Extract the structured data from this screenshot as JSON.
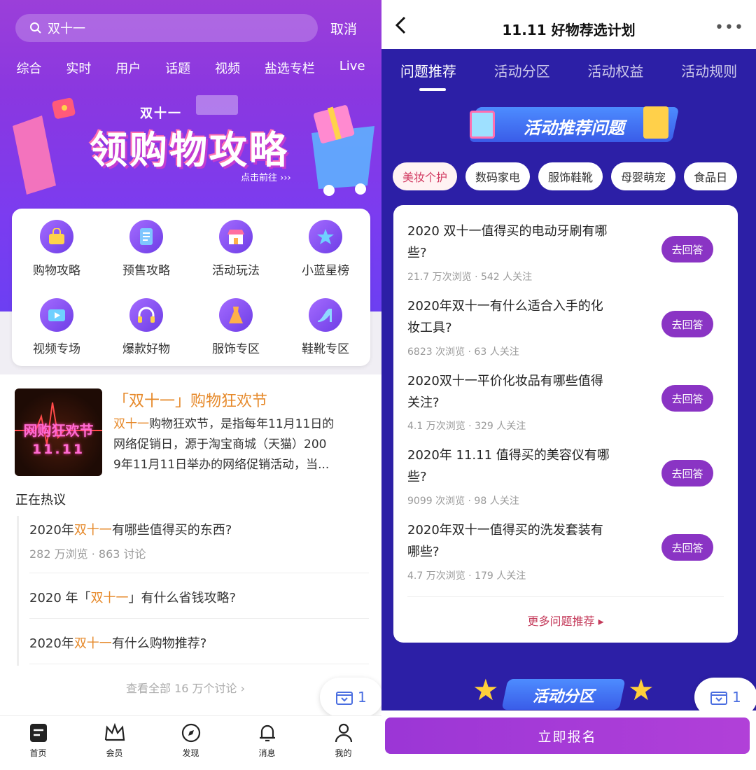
{
  "left": {
    "search": {
      "query": "双十一",
      "cancel": "取消"
    },
    "tabs": [
      "综合",
      "实时",
      "用户",
      "话题",
      "视频",
      "盐选专栏",
      "Live"
    ],
    "banner": {
      "pre": "双十一",
      "title": "领购物攻略",
      "cta": "点击前往 ›››"
    },
    "grid": [
      {
        "label": "购物攻略",
        "icon": "shopping-bag-icon"
      },
      {
        "label": "预售攻略",
        "icon": "document-icon"
      },
      {
        "label": "活动玩法",
        "icon": "store-icon"
      },
      {
        "label": "小蓝星榜",
        "icon": "star-icon"
      },
      {
        "label": "视频专场",
        "icon": "video-icon"
      },
      {
        "label": "爆款好物",
        "icon": "headphones-icon"
      },
      {
        "label": "服饰专区",
        "icon": "dress-icon"
      },
      {
        "label": "鞋靴专区",
        "icon": "high-heel-icon"
      }
    ],
    "topic": {
      "thumb_line1": "网购狂欢节",
      "thumb_line2": "11.11",
      "title": "「双十一」购物狂欢节",
      "desc_hl": "双十一",
      "desc_line1_rest": "购物狂欢节，是指每年11月11日的",
      "desc_line2": "网络促销日，源于淘宝商城（天猫）200",
      "desc_line3": "9年11月11日举办的网络促销活动，当..."
    },
    "hot": {
      "heading": "正在热议",
      "items": [
        {
          "pre": "2020年",
          "hl": "双十一",
          "post": "有哪些值得买的东西?",
          "meta": "282 万浏览 · 863 讨论"
        },
        {
          "pre": "2020 年「",
          "hl": "双十一",
          "post": "」有什么省钱攻略?",
          "meta": ""
        },
        {
          "pre": "2020年",
          "hl": "双十一",
          "post": "有什么购物推荐?",
          "meta": ""
        }
      ],
      "view_all": "查看全部 16 万个讨论  ›"
    },
    "float_count": "1",
    "nav": [
      {
        "label": "首页",
        "icon": "home-icon"
      },
      {
        "label": "会员",
        "icon": "crown-icon"
      },
      {
        "label": "发现",
        "icon": "compass-icon"
      },
      {
        "label": "消息",
        "icon": "bell-icon"
      },
      {
        "label": "我的",
        "icon": "profile-icon"
      }
    ]
  },
  "right": {
    "title": "11.11 好物荐选计划",
    "more": "•••",
    "tabs": [
      "问题推荐",
      "活动分区",
      "活动权益",
      "活动规则"
    ],
    "banner": "活动推荐问题",
    "chips": [
      "美妆个护",
      "数码家电",
      "服饰鞋靴",
      "母婴萌宠",
      "食品日"
    ],
    "questions": [
      {
        "line1": "2020 双十一值得买的电动牙刷有哪",
        "line2": "些?",
        "meta": "21.7 万次浏览 · 542 人关注"
      },
      {
        "line1": "2020年双十一有什么适合入手的化",
        "line2": "妆工具?",
        "meta": "6823 次浏览 · 63 人关注"
      },
      {
        "line1": "2020双十一平价化妆品有哪些值得",
        "line2": "关注?",
        "meta": "4.1 万次浏览 · 329 人关注"
      },
      {
        "line1": "2020年 11.11 值得买的美容仪有哪",
        "line2": "些?",
        "meta": "9099 次浏览 · 98 人关注"
      },
      {
        "line1": "2020年双十一值得买的洗发套装有",
        "line2": "哪些?",
        "meta": "4.7 万次浏览 · 179 人关注"
      }
    ],
    "answer_label": "去回答",
    "more_link": "更多问题推荐 ▸",
    "zone_banner": "活动分区",
    "float_count": "1",
    "register": "立即报名"
  },
  "colors": {
    "purple": "#8a37e0",
    "navy": "#2c1fa6",
    "orange": "#e6892a",
    "answer": "#8a34c4"
  }
}
